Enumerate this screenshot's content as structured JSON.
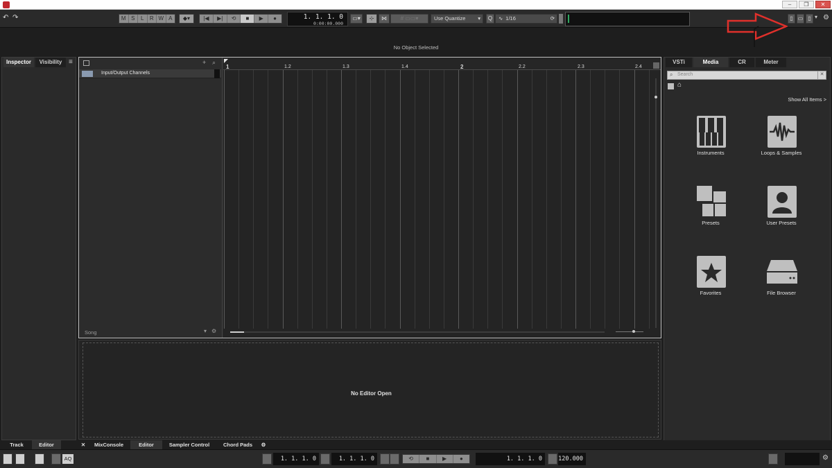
{
  "titlebar": {
    "text": ""
  },
  "toolbar": {
    "undo_icon": "undo-icon",
    "redo_icon": "redo-icon",
    "state_buttons": [
      "M",
      "S",
      "L",
      "R",
      "W",
      "A"
    ],
    "position_primary": "1. 1. 1.   0",
    "position_secondary": "0:00:00.000",
    "quantize_label": "Use Quantize",
    "quantize_value": "1/16"
  },
  "status": {
    "message": "No Object Selected"
  },
  "left_zone": {
    "tabs": [
      "Inspector",
      "Visibility"
    ]
  },
  "project": {
    "track_name": "Input/Output Channels",
    "song_label": "Song",
    "ruler": {
      "bars": [
        "1",
        "2"
      ],
      "beats": [
        "1.2",
        "1.3",
        "1.4",
        "2.2",
        "2.3",
        "2.4"
      ]
    }
  },
  "editor": {
    "message": "No Editor Open"
  },
  "right_zone": {
    "tabs": [
      "VSTi",
      "Media",
      "CR",
      "Meter"
    ],
    "active_tab": "Media",
    "search_placeholder": "Search",
    "show_all": "Show All Items >",
    "tiles": [
      {
        "label": "Instruments",
        "icon": "piano-keys-icon"
      },
      {
        "label": "Loops & Samples",
        "icon": "waveform-icon"
      },
      {
        "label": "Presets",
        "icon": "presets-grid-icon"
      },
      {
        "label": "User Presets",
        "icon": "user-icon"
      },
      {
        "label": "Favorites",
        "icon": "star-icon"
      },
      {
        "label": "File Browser",
        "icon": "drive-icon"
      }
    ]
  },
  "bottom_tabs": {
    "left": [
      "Track",
      "Editor"
    ],
    "lower": [
      "MixConsole",
      "Editor",
      "Sampler Control",
      "Chord Pads"
    ]
  },
  "transport": {
    "aq_label": "AQ",
    "left_locator": "1. 1. 1.   0",
    "right_locator": "1. 1. 1.   0",
    "primary_position": "1. 1. 1.   0",
    "tempo": "120.000"
  },
  "annotation": {
    "arrow_color": "#e0302b"
  }
}
